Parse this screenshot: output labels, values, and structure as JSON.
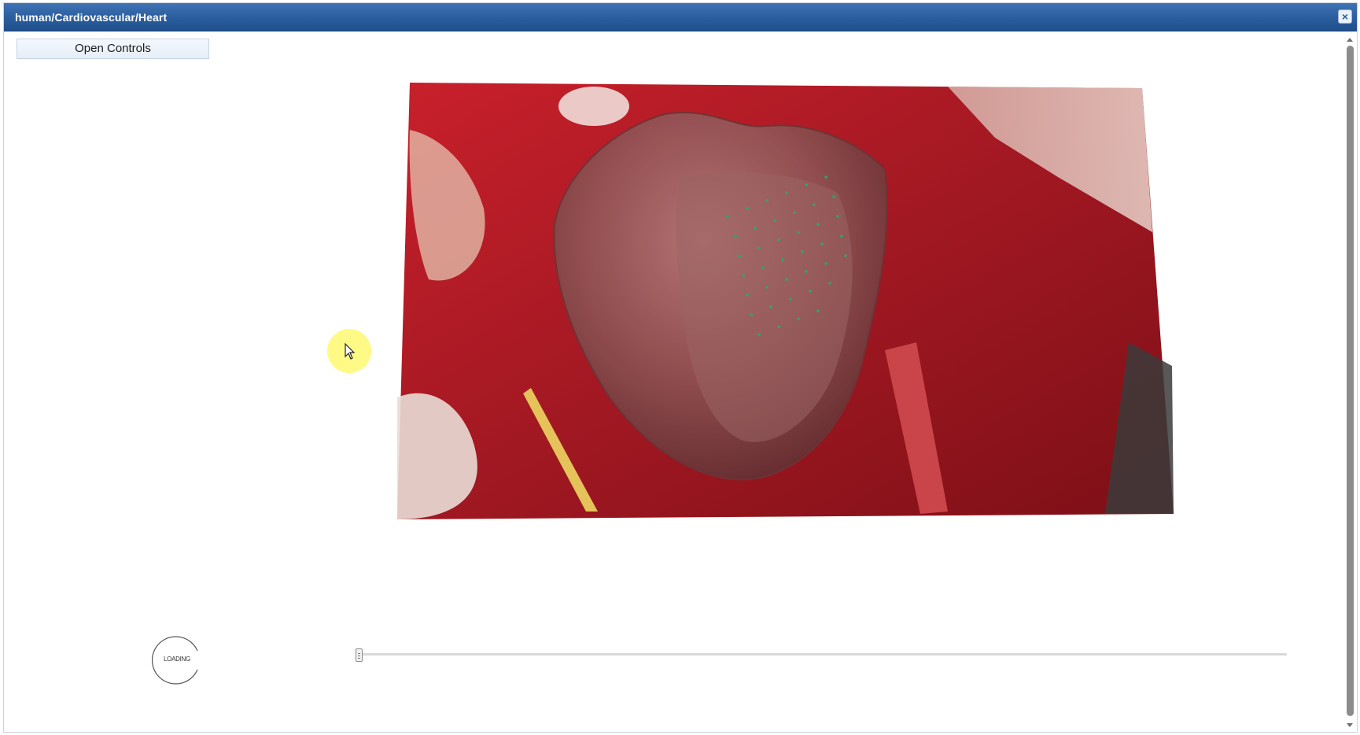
{
  "window": {
    "title": "human/Cardiovascular/Heart",
    "close_icon": "close-icon"
  },
  "controls": {
    "open_label": "Open Controls"
  },
  "video": {
    "content": "surgical-heart-scene-with-3d-heart-overlay"
  },
  "loading": {
    "label": "LOADING"
  },
  "timeline": {
    "progress": 0.0
  },
  "colors": {
    "titlebar": "#2c5f9f",
    "cursor_highlight": "#fffa78"
  }
}
